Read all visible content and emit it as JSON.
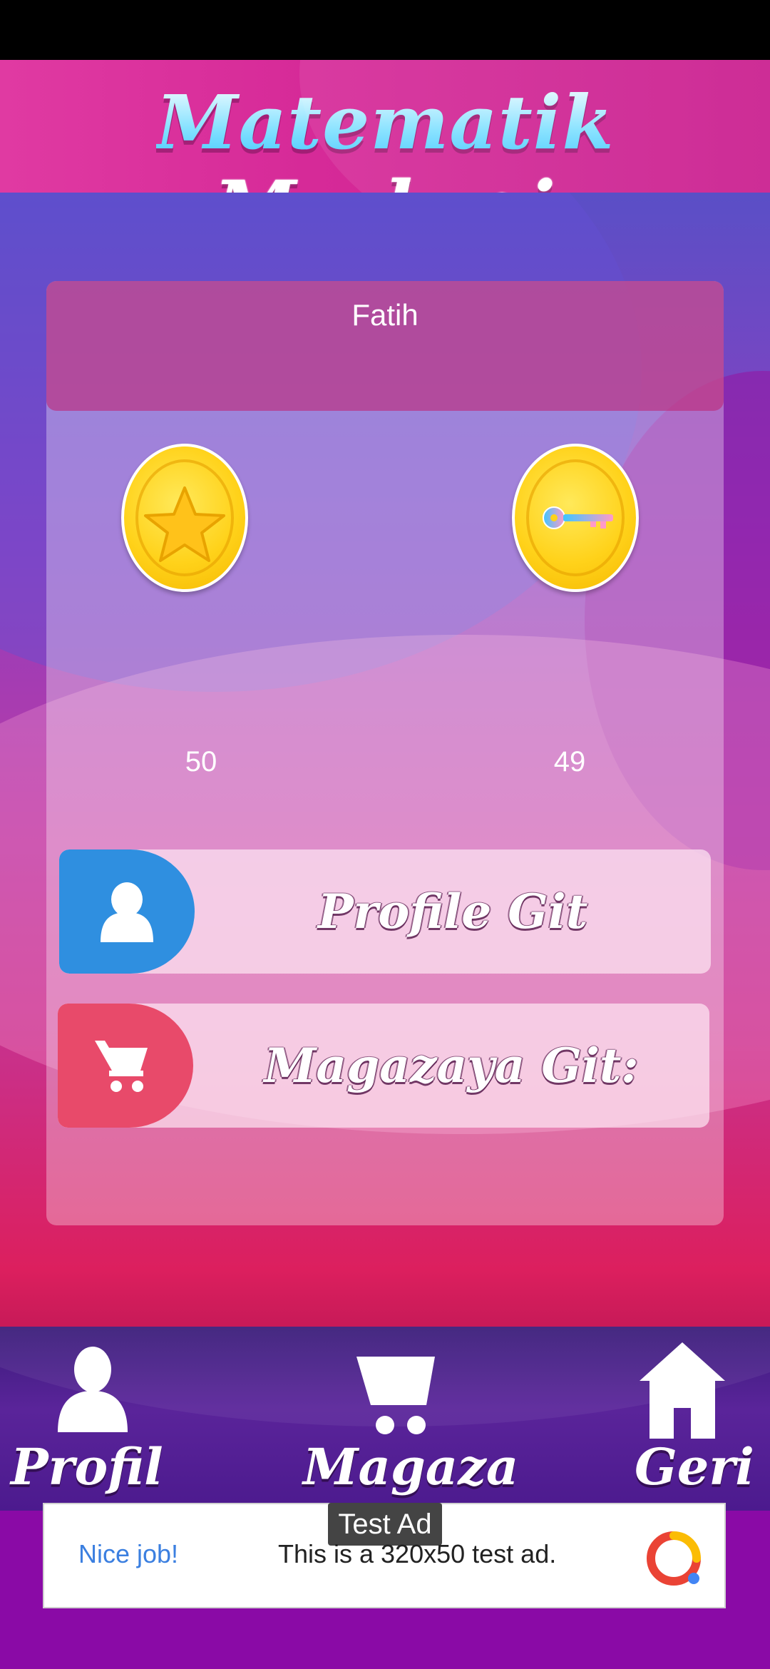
{
  "header": {
    "title_part1": "Matematik",
    "title_part2": "Merkezi"
  },
  "player": {
    "name": "Fatih"
  },
  "stats": {
    "stars": {
      "icon": "star-coin-icon",
      "value": "50"
    },
    "keys": {
      "icon": "key-coin-icon",
      "value": "49"
    }
  },
  "actions": {
    "profile": {
      "label": "Profile Git",
      "icon": "user-icon",
      "color": "#2f8fe0"
    },
    "store": {
      "label": "Magazaya Git:",
      "icon": "cart-icon",
      "color": "#e84a6a"
    }
  },
  "bottom_nav": {
    "items": [
      {
        "label": "Profil",
        "icon": "user-icon"
      },
      {
        "label": "Magaza",
        "icon": "cart-icon"
      },
      {
        "label": "Geri",
        "icon": "home-icon"
      }
    ]
  },
  "ad": {
    "badge": "Test Ad",
    "cta": "Nice job!",
    "text": "This is a 320x50 test ad.",
    "logo_icon": "adsense-logo-icon"
  }
}
